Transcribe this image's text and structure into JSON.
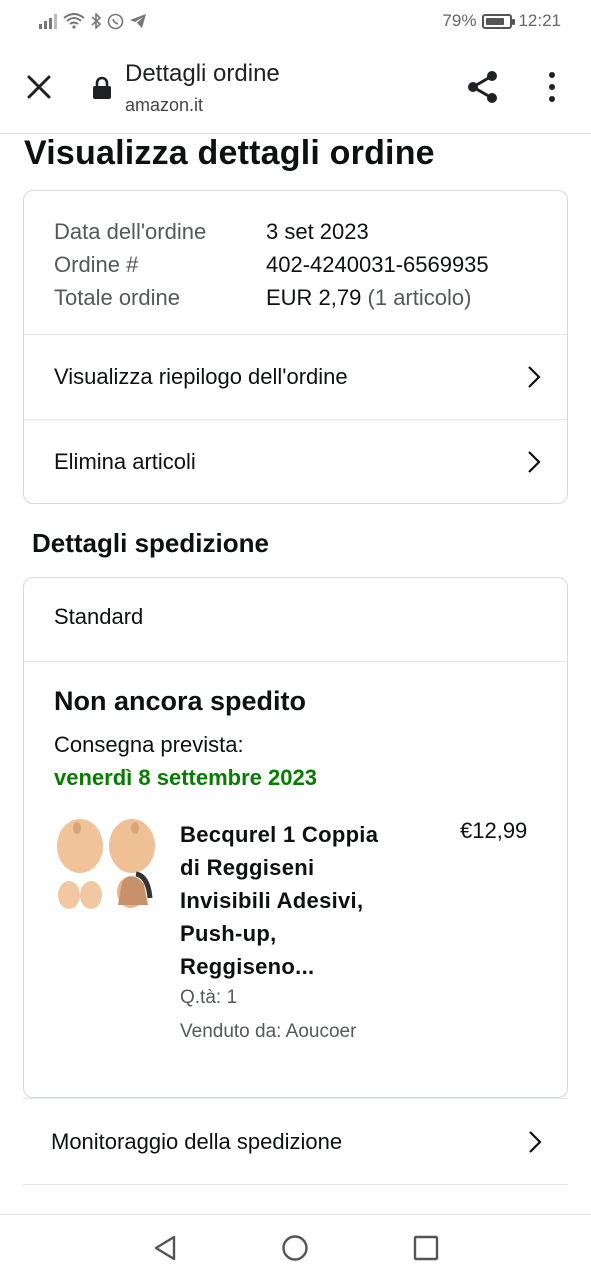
{
  "status_bar": {
    "battery_percent": "79%",
    "battery_level": 0.79,
    "time": "12:21"
  },
  "browser": {
    "title": "Dettagli ordine",
    "host": "amazon.it",
    "icons": [
      "close-icon",
      "lock-icon",
      "share-icon",
      "more-vert-icon"
    ]
  },
  "page": {
    "title": "Visualizza dettagli ordine"
  },
  "order": {
    "date_label": "Data dell'ordine",
    "date_value": "3 set 2023",
    "number_label": "Ordine #",
    "number_value": "402-4240031-6569935",
    "total_label": "Totale ordine",
    "total_value": "EUR 2,79",
    "total_items": "(1 articolo)",
    "summary_link": "Visualizza riepilogo dell'ordine",
    "delete_link": "Elimina articoli"
  },
  "shipping": {
    "section_title": "Dettagli spedizione",
    "method": "Standard",
    "status": "Non ancora spedito",
    "eta_label": "Consegna prevista:",
    "eta_date": "venerdì 8 settembre 2023",
    "status_color": "#067d00"
  },
  "product": {
    "title_lines": [
      "Becqurel 1 Coppia",
      "di Reggiseni",
      "Invisibili Adesivi,",
      "Push-up,",
      "Reggiseno..."
    ],
    "price": "€12,99",
    "qty": "Q.tà: 1",
    "seller": "Venduto da: Aoucoer"
  },
  "bottom_links": {
    "tracking": "Monitoraggio della spedizione",
    "cut_row": ""
  },
  "colors": {
    "text": "#0f1111",
    "muted": "#565959",
    "border": "#d5d9d9",
    "green": "#067d00"
  }
}
